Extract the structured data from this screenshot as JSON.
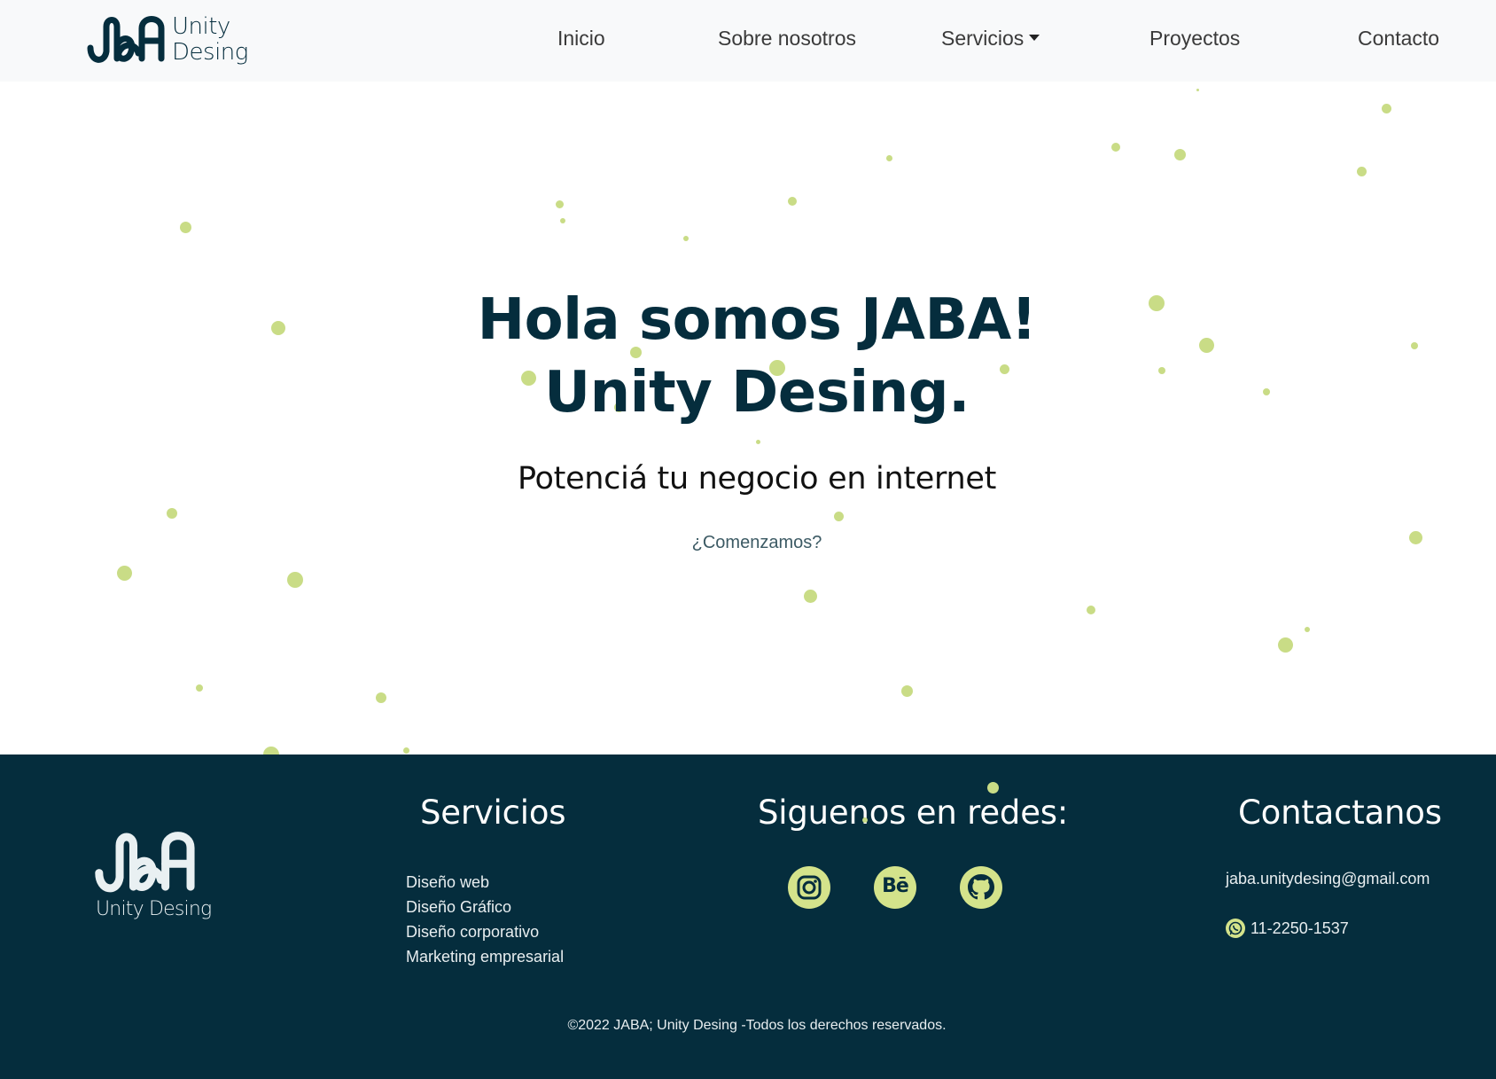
{
  "navbar": {
    "logo_text_1": "Unity",
    "logo_text_2": "Desing",
    "items": [
      {
        "label": "Inicio"
      },
      {
        "label": "Sobre nosotros"
      },
      {
        "label": "Servicios"
      },
      {
        "label": "Proyectos"
      },
      {
        "label": "Contacto"
      }
    ]
  },
  "hero": {
    "title_line1": "Hola somos JABA!",
    "title_line2": "Unity Desing.",
    "subtitle": "Potenciá tu negocio en internet",
    "cta": "¿Comenzamos?"
  },
  "footer": {
    "logo_text": "Unity Desing",
    "services_heading": "Servicios",
    "services": [
      "Diseño web",
      "Diseño Gráfico",
      "Diseño corporativo",
      "Marketing empresarial"
    ],
    "social_heading": "Siguenos en redes:",
    "social": [
      "instagram-icon",
      "behance-icon",
      "github-icon"
    ],
    "behance_glyph": "Bē",
    "contact_heading": "Contactanos",
    "email": "jaba.unitydesing@gmail.com",
    "phone": "11-2250-1537",
    "copyright": "©2022 JABA; Unity Desing -Todos los derechos reservados."
  },
  "colors": {
    "navy": "#052d3d",
    "accent": "#c9dc86",
    "navbar_bg": "#f8f9fa"
  }
}
